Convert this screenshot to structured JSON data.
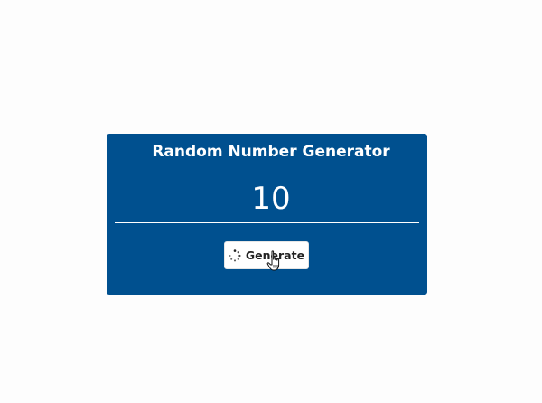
{
  "widget": {
    "title": "Random Number Generator",
    "number": "10",
    "generate_label": "Generate",
    "loading_icon": "spinner-icon",
    "cursor_icon": "hand-pointer-icon"
  },
  "colors": {
    "card_background": "#00508f",
    "text": "#ffffff",
    "button_background": "#ffffff",
    "button_text": "#222222"
  }
}
